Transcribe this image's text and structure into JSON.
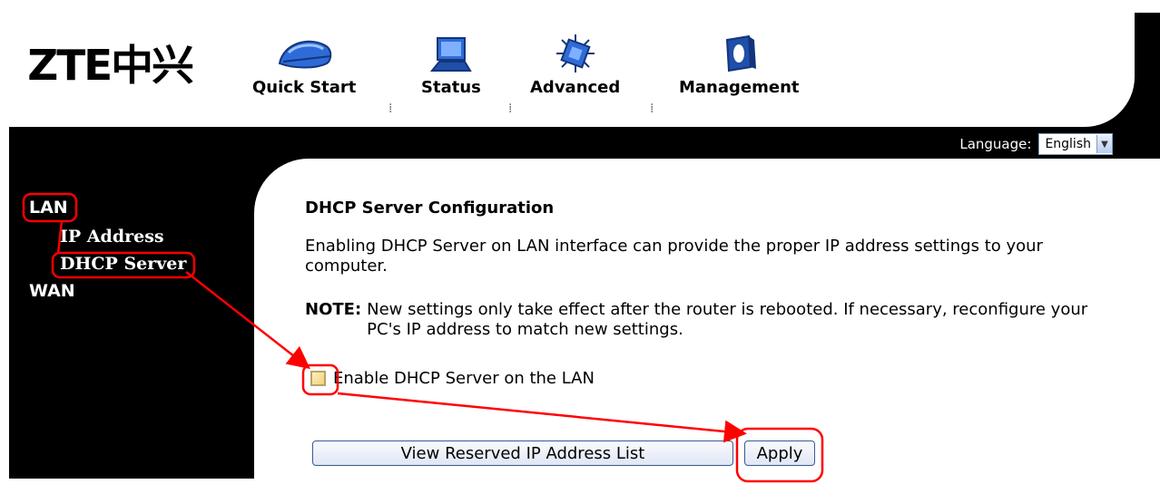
{
  "brand": {
    "logo_text": "ZTE中兴"
  },
  "nav": {
    "items": [
      {
        "label": "Quick Start",
        "icon": "quick-start-icon"
      },
      {
        "label": "Status",
        "icon": "status-icon"
      },
      {
        "label": "Advanced",
        "icon": "advanced-icon"
      },
      {
        "label": "Management",
        "icon": "management-icon"
      }
    ],
    "separator": "⁞"
  },
  "language": {
    "label": "Language:",
    "selected": "English"
  },
  "sidebar": {
    "items": [
      {
        "label": "LAN"
      },
      {
        "label": "IP Address"
      },
      {
        "label": "DHCP Server"
      },
      {
        "label": "WAN"
      }
    ]
  },
  "content": {
    "title": "DHCP Server Configuration",
    "description": "Enabling DHCP Server on LAN interface can provide the proper IP address settings to your computer.",
    "note_label": "NOTE:",
    "note_text": "New settings only take effect after the router is rebooted. If necessary, reconfigure your PC's IP address to match new settings.",
    "checkbox_label": "Enable DHCP Server on the LAN",
    "checkbox_checked": false,
    "view_button": "View Reserved IP Address List",
    "apply_button": "Apply"
  },
  "colors": {
    "annotation": "#ff0000",
    "background": "#000000",
    "panel": "#ffffff"
  }
}
